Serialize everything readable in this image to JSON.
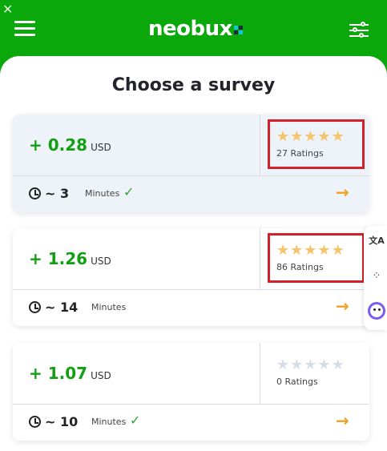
{
  "header": {
    "logo_text": "neobux",
    "brand_color": "#0aa80a",
    "menu_icon": "hamburger-menu-icon",
    "filter_icon": "sliders-icon",
    "close_icon": "close-icon"
  },
  "page": {
    "title": "Choose a survey"
  },
  "surveys": [
    {
      "price_prefix": "+",
      "price": "0.28",
      "currency": "USD",
      "stars_filled": 5,
      "stars_total": 5,
      "ratings_label": "27 Ratings",
      "duration_prefix": "~",
      "duration": "3",
      "duration_unit": "Minutes",
      "verified": true,
      "highlighted": true
    },
    {
      "price_prefix": "+",
      "price": "1.26",
      "currency": "USD",
      "stars_filled": 5,
      "stars_total": 5,
      "ratings_label": "86 Ratings",
      "duration_prefix": "~",
      "duration": "14",
      "duration_unit": "Minutes",
      "verified": false,
      "highlighted": true
    },
    {
      "price_prefix": "+",
      "price": "1.07",
      "currency": "USD",
      "stars_filled": 0,
      "stars_total": 5,
      "ratings_label": "0 Ratings",
      "duration_prefix": "~",
      "duration": "10",
      "duration_unit": "Minutes",
      "verified": true,
      "highlighted": false
    }
  ],
  "colors": {
    "price": "#12a012",
    "star_filled": "#f7c36a",
    "star_empty": "#d7dde7",
    "arrow": "#f0a020",
    "highlight_box": "#d4202a"
  },
  "side_tools": [
    "translate-icon",
    "grid-apps-icon",
    "assistant-icon"
  ]
}
